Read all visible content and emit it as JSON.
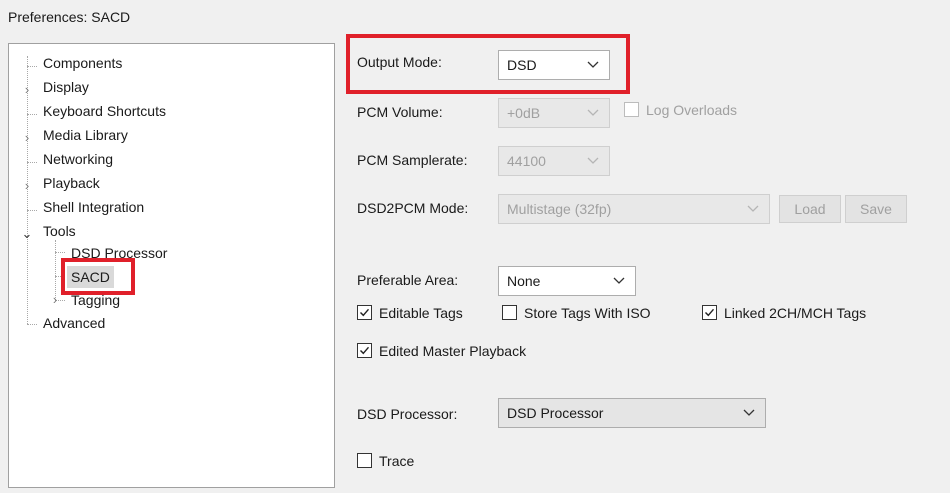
{
  "window": {
    "title": "Preferences: SACD"
  },
  "tree": {
    "items": [
      {
        "label": "Components"
      },
      {
        "label": "Display"
      },
      {
        "label": "Keyboard Shortcuts"
      },
      {
        "label": "Media Library"
      },
      {
        "label": "Networking"
      },
      {
        "label": "Playback"
      },
      {
        "label": "Shell Integration"
      },
      {
        "label": "Tools"
      },
      {
        "label": "DSD Processor"
      },
      {
        "label": "SACD"
      },
      {
        "label": "Tagging"
      },
      {
        "label": "Advanced"
      }
    ],
    "selected": "SACD"
  },
  "form": {
    "output_mode": {
      "label": "Output Mode:",
      "value": "DSD"
    },
    "pcm_volume": {
      "label": "PCM Volume:",
      "value": "+0dB"
    },
    "log_overloads": {
      "label": "Log Overloads",
      "checked": false
    },
    "pcm_samplerate": {
      "label": "PCM Samplerate:",
      "value": "44100"
    },
    "dsd2pcm_mode": {
      "label": "DSD2PCM Mode:",
      "value": "Multistage (32fp)"
    },
    "load_button": "Load",
    "save_button": "Save",
    "preferable_area": {
      "label": "Preferable Area:",
      "value": "None"
    },
    "editable_tags": {
      "label": "Editable Tags",
      "checked": true
    },
    "store_tags_iso": {
      "label": "Store Tags With ISO",
      "checked": false
    },
    "linked_tags": {
      "label": "Linked 2CH/MCH Tags",
      "checked": true
    },
    "edited_master": {
      "label": "Edited Master Playback",
      "checked": true
    },
    "dsd_processor": {
      "label": "DSD Processor:",
      "value": "DSD Processor"
    },
    "trace": {
      "label": "Trace",
      "checked": false
    }
  },
  "colors": {
    "highlight": "#e0202a",
    "selection": "#d9d9d9"
  }
}
